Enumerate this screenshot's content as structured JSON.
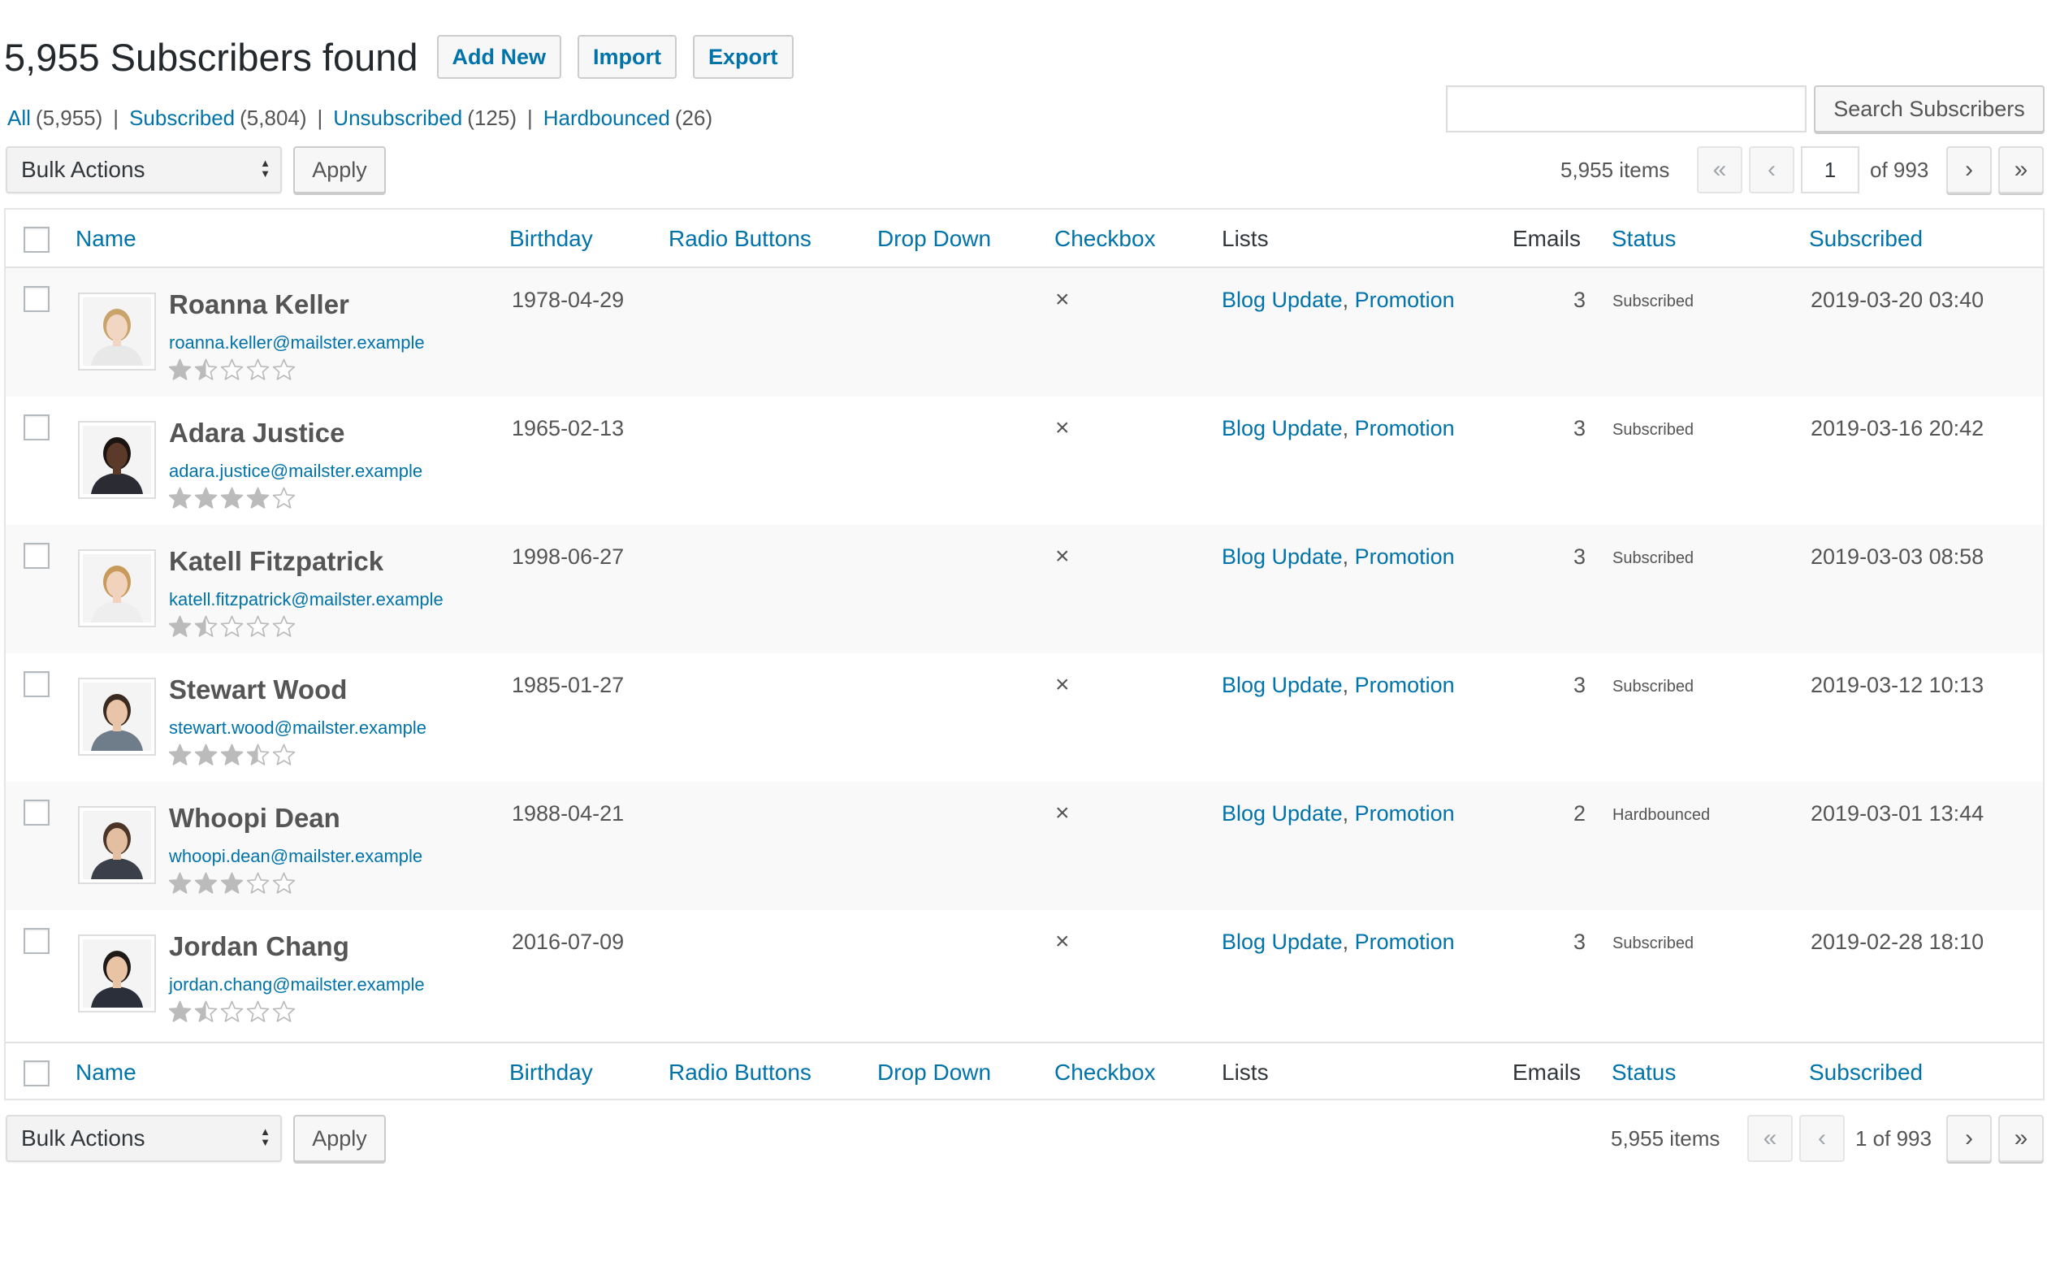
{
  "header": {
    "title": "5,955 Subscribers found",
    "add_new": "Add New",
    "import": "Import",
    "export": "Export"
  },
  "filters": [
    {
      "label": "All",
      "count": "(5,955)"
    },
    {
      "label": "Subscribed",
      "count": "(5,804)"
    },
    {
      "label": "Unsubscribed",
      "count": "(125)"
    },
    {
      "label": "Hardbounced",
      "count": "(26)"
    }
  ],
  "filter_separator": "|",
  "search": {
    "value": "",
    "button": "Search Subscribers"
  },
  "tablenav_top": {
    "bulk_actions": "Bulk Actions",
    "apply": "Apply",
    "items": "5,955 items",
    "first": "«",
    "prev": "‹",
    "current_page": "1",
    "of_pages": "of 993",
    "next": "›",
    "last": "»"
  },
  "tablenav_bottom": {
    "bulk_actions": "Bulk Actions",
    "apply": "Apply",
    "items": "5,955 items",
    "first": "«",
    "prev": "‹",
    "page_label": "1 of 993",
    "next": "›",
    "last": "»"
  },
  "columns": {
    "name": "Name",
    "birthday": "Birthday",
    "radio_buttons": "Radio Buttons",
    "drop_down": "Drop Down",
    "checkbox": "Checkbox",
    "lists": "Lists",
    "emails": "Emails",
    "status": "Status",
    "subscribed": "Subscribed"
  },
  "list_separator": ",",
  "rows": [
    {
      "name": "Roanna Keller",
      "email": "roanna.keller@mailster.example",
      "rating": 1.5,
      "birthday": "1978-04-29",
      "checkbox": "×",
      "list1": "Blog Update",
      "list2": "Promotion",
      "emails": "3",
      "status": "Subscribed",
      "subscribed": "2019-03-20 03:40"
    },
    {
      "name": "Adara Justice",
      "email": "adara.justice@mailster.example",
      "rating": 4,
      "birthday": "1965-02-13",
      "checkbox": "×",
      "list1": "Blog Update",
      "list2": "Promotion",
      "emails": "3",
      "status": "Subscribed",
      "subscribed": "2019-03-16 20:42"
    },
    {
      "name": "Katell Fitzpatrick",
      "email": "katell.fitzpatrick@mailster.example",
      "rating": 1.5,
      "birthday": "1998-06-27",
      "checkbox": "×",
      "list1": "Blog Update",
      "list2": "Promotion",
      "emails": "3",
      "status": "Subscribed",
      "subscribed": "2019-03-03 08:58"
    },
    {
      "name": "Stewart Wood",
      "email": "stewart.wood@mailster.example",
      "rating": 3.5,
      "birthday": "1985-01-27",
      "checkbox": "×",
      "list1": "Blog Update",
      "list2": "Promotion",
      "emails": "3",
      "status": "Subscribed",
      "subscribed": "2019-03-12 10:13"
    },
    {
      "name": "Whoopi Dean",
      "email": "whoopi.dean@mailster.example",
      "rating": 3,
      "birthday": "1988-04-21",
      "checkbox": "×",
      "list1": "Blog Update",
      "list2": "Promotion",
      "emails": "2",
      "status": "Hardbounced",
      "subscribed": "2019-03-01 13:44"
    },
    {
      "name": "Jordan Chang",
      "email": "jordan.chang@mailster.example",
      "rating": 1.5,
      "birthday": "2016-07-09",
      "checkbox": "×",
      "list1": "Blog Update",
      "list2": "Promotion",
      "emails": "3",
      "status": "Subscribed",
      "subscribed": "2019-02-28 18:10"
    }
  ],
  "colors": {
    "link": "#0073aa",
    "text": "#555555",
    "row_alt": "#f9f9f9",
    "star": "#bbbbbb"
  }
}
